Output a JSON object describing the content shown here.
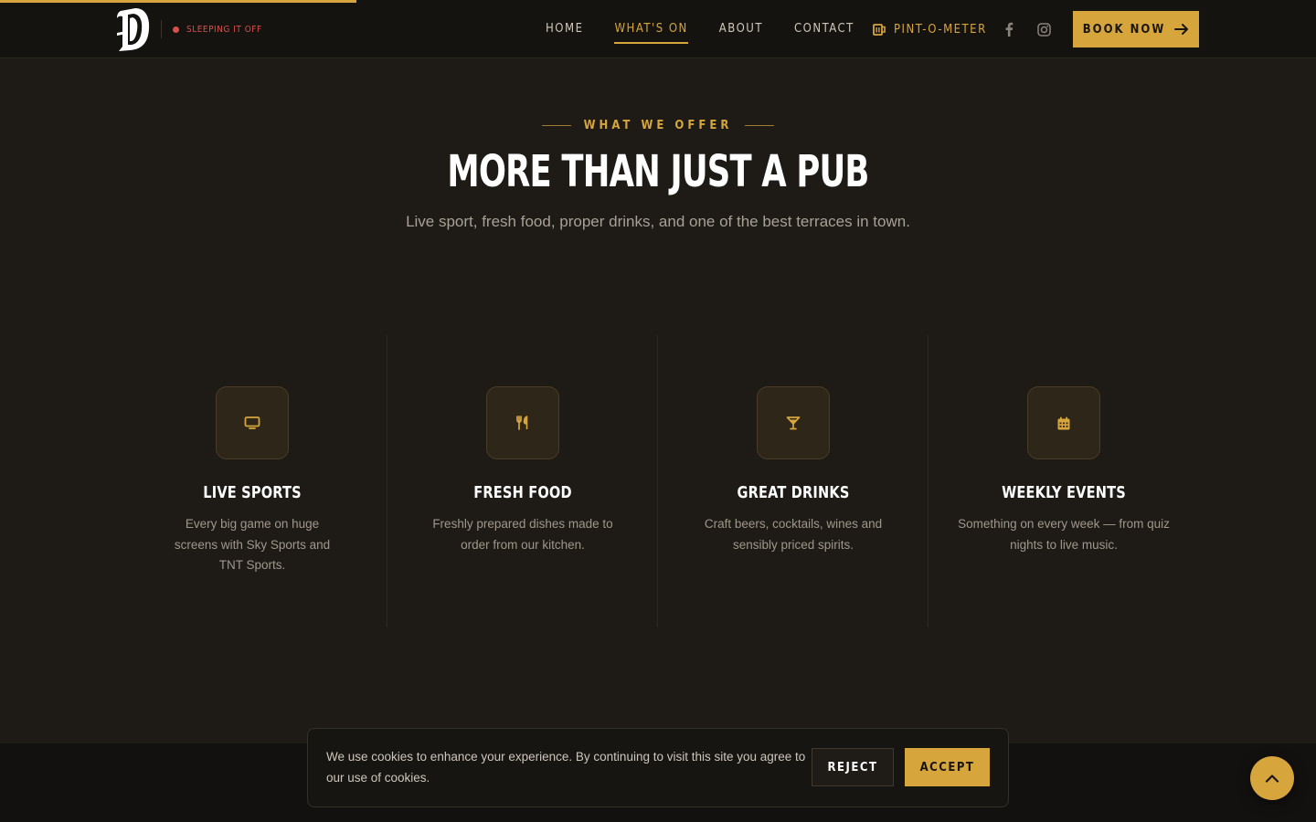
{
  "nav": {
    "status": "SLEEPING IT OFF",
    "items": [
      {
        "label": "HOME",
        "active": false
      },
      {
        "label": "WHAT'S ON",
        "active": true
      },
      {
        "label": "ABOUT",
        "active": false
      },
      {
        "label": "CONTACT",
        "active": false
      }
    ],
    "pint_label": "PINT-O-METER",
    "book_label": "BOOK NOW",
    "icons": {
      "facebook": "facebook-icon",
      "instagram": "instagram-icon",
      "pint": "beer-mug-icon",
      "arrow": "arrow-right-icon"
    }
  },
  "hero": {
    "eyebrow": "WHAT WE OFFER",
    "title": "MORE THAN JUST A PUB",
    "subtitle": "Live sport, fresh food, proper drinks, and one of the best terraces in town."
  },
  "features": [
    {
      "icon": "tv-icon",
      "title": "LIVE SPORTS",
      "desc": "Every big game on huge screens with Sky Sports and TNT Sports."
    },
    {
      "icon": "utensils-icon",
      "title": "FRESH FOOD",
      "desc": "Freshly prepared dishes made to order from our kitchen."
    },
    {
      "icon": "cocktail-icon",
      "title": "GREAT DRINKS",
      "desc": "Craft beers, cocktails, wines and sensibly priced spirits."
    },
    {
      "icon": "calendar-icon",
      "title": "WEEKLY EVENTS",
      "desc": "Something on every week — from quiz nights to live music."
    }
  ],
  "cookie": {
    "text": "We use cookies to enhance your experience. By continuing to visit this site you agree to our use of cookies.",
    "reject": "REJECT",
    "accept": "ACCEPT"
  },
  "colors": {
    "accent": "#d6a53c",
    "background": "#1e1b17",
    "status": "#d9504a"
  }
}
